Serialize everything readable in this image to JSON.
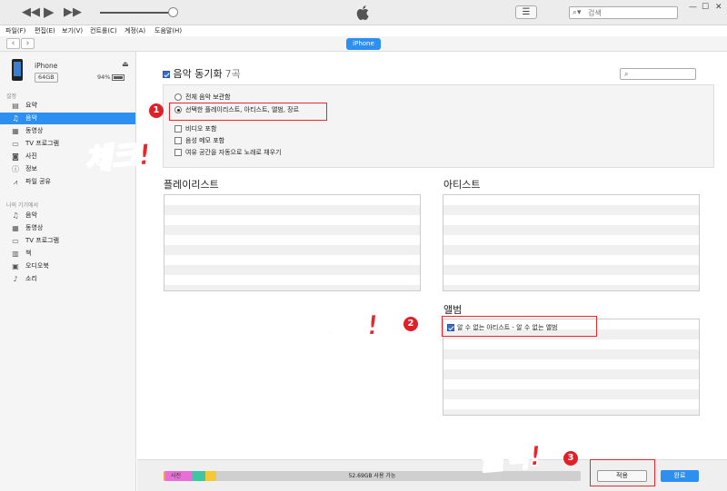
{
  "window": {
    "search_placeholder": "검색",
    "min": "—",
    "max": "☐",
    "close": "✕"
  },
  "player": {
    "rewind": "◀◀",
    "play": "▶",
    "forward": "▶▶",
    "volume": 0.97
  },
  "menubar": [
    "파일(F)",
    "편집(E)",
    "보기(V)",
    "컨트롤(C)",
    "계정(A)",
    "도움말(H)"
  ],
  "nav": {
    "back": "‹",
    "forward": "›",
    "device": "iPhone"
  },
  "device": {
    "name": "iPhone",
    "capacity": "64GB",
    "battery": "94%"
  },
  "sidebar": {
    "settings_head": "설정",
    "settings": [
      {
        "icon": "list-icon",
        "glyph": "▤",
        "label": "요약"
      },
      {
        "icon": "music-note-icon",
        "glyph": "♫",
        "label": "음악"
      },
      {
        "icon": "film-icon",
        "glyph": "▦",
        "label": "동영상"
      },
      {
        "icon": "tv-icon",
        "glyph": "▭",
        "label": "TV 프로그램"
      },
      {
        "icon": "camera-icon",
        "glyph": "◙",
        "label": "사진"
      },
      {
        "icon": "info-icon",
        "glyph": "ⓘ",
        "label": "정보"
      },
      {
        "icon": "app-store-icon",
        "glyph": "⩘",
        "label": "파일 공유"
      }
    ],
    "mydevice_head": "나의 기기에서",
    "mydevice": [
      {
        "icon": "music-note-icon",
        "glyph": "♫",
        "label": "음악"
      },
      {
        "icon": "film-icon",
        "glyph": "▦",
        "label": "동영상"
      },
      {
        "icon": "tv-icon",
        "glyph": "▭",
        "label": "TV 프로그램"
      },
      {
        "icon": "book-icon",
        "glyph": "▥",
        "label": "책"
      },
      {
        "icon": "audiobook-icon",
        "glyph": "▣",
        "label": "오디오북"
      },
      {
        "icon": "bell-icon",
        "glyph": "♪",
        "label": "소리"
      }
    ]
  },
  "main": {
    "sync_label": "음악 동기화",
    "sync_count": "7곡",
    "options": {
      "entire_library": "전체 음악 보관함",
      "selected": "선택한 플레이리스트, 아티스트, 앨범, 장르",
      "include_videos": "비디오 포함",
      "include_voice_memos": "음성 메모 포함",
      "autofill": "여유 공간을 자동으로 노래로 채우기"
    },
    "playlists_title": "플레이리스트",
    "artists_title": "아티스트",
    "albums_title": "앨범",
    "album_item": "알 수 없는 아티스트 - 알 수 없는 앨범"
  },
  "annotations": {
    "badge1": "1",
    "badge2": "2",
    "badge3": "3",
    "check1": "체크!",
    "check2": "체크!",
    "click": "클릭!"
  },
  "bottom": {
    "photos_label": "사진",
    "storage_text": "52.69GB 사용 가능",
    "apply": "적용",
    "done": "완료"
  },
  "colors": {
    "accent": "#2d8ff0",
    "annotation_red": "#e8262e",
    "storage_photos": "#e86fd6",
    "storage_apps": "#f0a234",
    "storage_other": "#3cc6a3",
    "storage_yellow": "#f5c836"
  }
}
